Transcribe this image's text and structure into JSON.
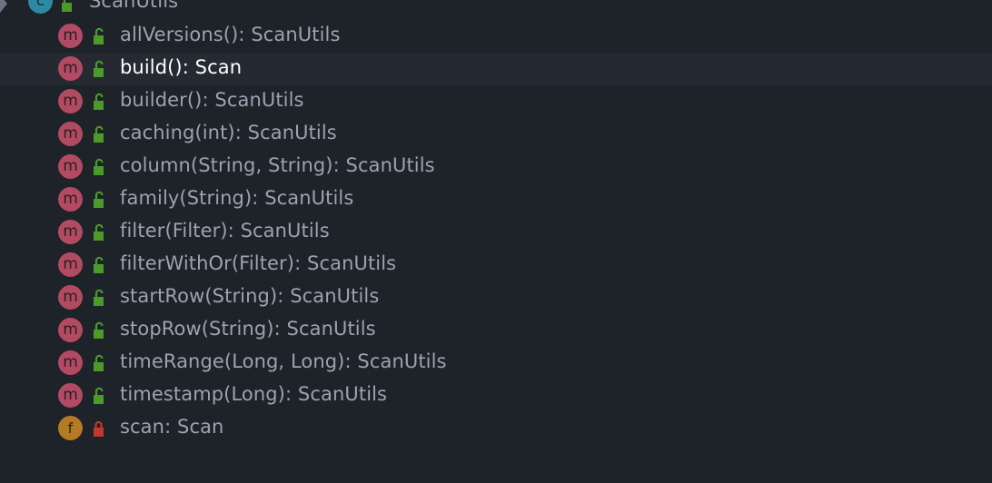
{
  "tree": {
    "class_node": {
      "label": "ScanUtils",
      "kind_icon": "class-icon",
      "kind_letter": "c",
      "visibility_icon": "public-unlocked-icon"
    },
    "members": [
      {
        "label": "allVersions(): ScanUtils",
        "kind_letter": "m",
        "kind_icon": "method-icon",
        "visibility_icon": "public-unlocked-icon",
        "selected": false
      },
      {
        "label": "build(): Scan",
        "kind_letter": "m",
        "kind_icon": "method-icon",
        "visibility_icon": "public-unlocked-icon",
        "selected": true
      },
      {
        "label": "builder(): ScanUtils",
        "kind_letter": "m",
        "kind_icon": "method-icon",
        "visibility_icon": "public-unlocked-icon",
        "selected": false
      },
      {
        "label": "caching(int): ScanUtils",
        "kind_letter": "m",
        "kind_icon": "method-icon",
        "visibility_icon": "public-unlocked-icon",
        "selected": false
      },
      {
        "label": "column(String, String): ScanUtils",
        "kind_letter": "m",
        "kind_icon": "method-icon",
        "visibility_icon": "public-unlocked-icon",
        "selected": false
      },
      {
        "label": "family(String): ScanUtils",
        "kind_letter": "m",
        "kind_icon": "method-icon",
        "visibility_icon": "public-unlocked-icon",
        "selected": false
      },
      {
        "label": "filter(Filter): ScanUtils",
        "kind_letter": "m",
        "kind_icon": "method-icon",
        "visibility_icon": "public-unlocked-icon",
        "selected": false
      },
      {
        "label": "filterWithOr(Filter): ScanUtils",
        "kind_letter": "m",
        "kind_icon": "method-icon",
        "visibility_icon": "public-unlocked-icon",
        "selected": false
      },
      {
        "label": "startRow(String): ScanUtils",
        "kind_letter": "m",
        "kind_icon": "method-icon",
        "visibility_icon": "public-unlocked-icon",
        "selected": false
      },
      {
        "label": "stopRow(String): ScanUtils",
        "kind_letter": "m",
        "kind_icon": "method-icon",
        "visibility_icon": "public-unlocked-icon",
        "selected": false
      },
      {
        "label": "timeRange(Long, Long): ScanUtils",
        "kind_letter": "m",
        "kind_icon": "method-icon",
        "visibility_icon": "public-unlocked-icon",
        "selected": false
      },
      {
        "label": "timestamp(Long): ScanUtils",
        "kind_letter": "m",
        "kind_icon": "method-icon",
        "visibility_icon": "public-unlocked-icon",
        "selected": false
      },
      {
        "label": "scan: Scan",
        "kind_letter": "f",
        "kind_icon": "field-icon",
        "visibility_icon": "private-locked-icon",
        "selected": false
      }
    ]
  },
  "colors": {
    "background": "#1e2229",
    "selected_row": "#252a32",
    "text": "#9aa4b1",
    "selected_text": "#ffffff",
    "method_badge": "#b24b62",
    "field_badge": "#b57b22",
    "class_badge": "#2d8aa3",
    "public_lock": "#4c9a2a",
    "private_lock": "#c0392b"
  }
}
